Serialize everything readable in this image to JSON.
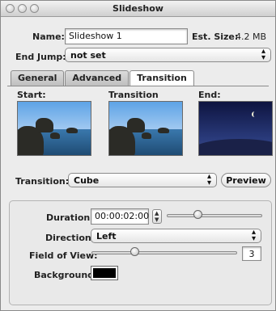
{
  "window": {
    "title": "Slideshow"
  },
  "header": {
    "name_label": "Name:",
    "name_value": "Slideshow 1",
    "est_size_label": "Est. Size:",
    "est_size_value": "4.2 MB",
    "end_jump_label": "End Jump:",
    "end_jump_value": "not set"
  },
  "tabs": [
    {
      "label": "General",
      "active": false
    },
    {
      "label": "Advanced",
      "active": false
    },
    {
      "label": "Transition",
      "active": true
    }
  ],
  "previews": {
    "start_label": "Start:",
    "transition_label": "Transition",
    "end_label": "End:"
  },
  "transition": {
    "label": "Transition:",
    "value": "Cube",
    "preview_button": "Preview"
  },
  "settings": {
    "duration_label": "Duration:",
    "duration_value": "00:00:02:00",
    "duration_slider_fraction": 0.33,
    "direction_label": "Direction:",
    "direction_value": "Left",
    "fov_label": "Field of View:",
    "fov_value": "3",
    "fov_slider_fraction": 0.3,
    "background_label": "Background:",
    "background_color": "#000000"
  },
  "icons": {
    "popup_arrows": "updown-arrows-icon",
    "stepper": "stepper-icon"
  }
}
